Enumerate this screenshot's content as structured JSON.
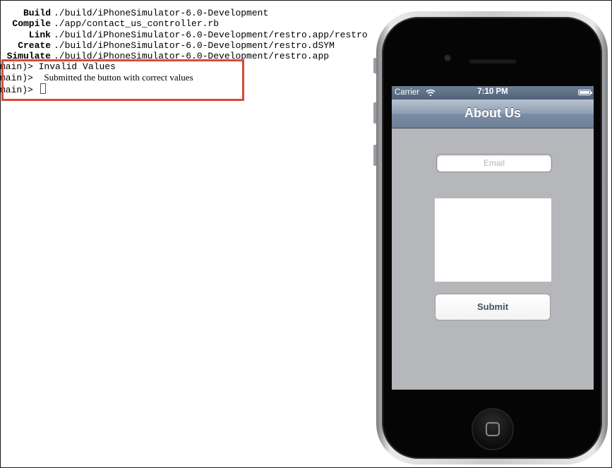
{
  "terminal": {
    "build_lines": [
      {
        "verb": "Build",
        "path": "./build/iPhoneSimulator-6.0-Development"
      },
      {
        "verb": "Compile",
        "path": "./app/contact_us_controller.rb"
      },
      {
        "verb": "Link",
        "path": "./build/iPhoneSimulator-6.0-Development/restro.app/restro"
      },
      {
        "verb": "Create",
        "path": "./build/iPhoneSimulator-6.0-Development/restro.dSYM"
      },
      {
        "verb": "Simulate",
        "path": "./build/iPhoneSimulator-6.0-Development/restro.app"
      }
    ],
    "prompt": "main)>",
    "output_lines": [
      "Invalid Values",
      "Submitted the button with correct values"
    ]
  },
  "highlight_color": "#d94a36",
  "simulator": {
    "status_bar": {
      "carrier": "Carrier",
      "time": "7:10 PM",
      "wifi_icon": "wifi-icon",
      "battery_icon": "battery-icon"
    },
    "nav_title": "About Us",
    "email_placeholder": "Email",
    "submit_label": "Submit",
    "nav_color": "#7a8ca3",
    "background_color": "#b6b7ba"
  }
}
